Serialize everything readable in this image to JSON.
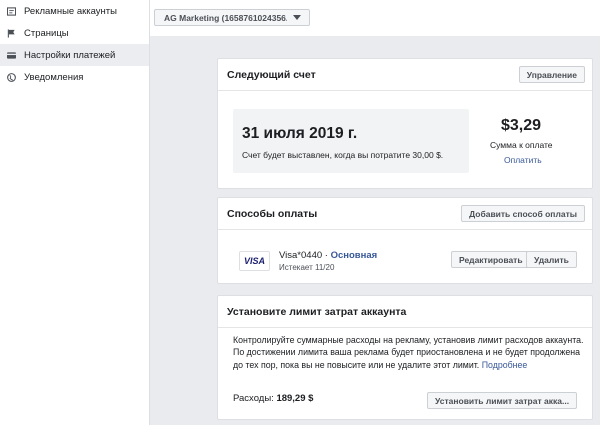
{
  "sidebar": {
    "items": [
      {
        "label": "Рекламные аккаунты",
        "icon": "ad-accounts-icon",
        "active": false
      },
      {
        "label": "Страницы",
        "icon": "flag-icon",
        "active": false
      },
      {
        "label": "Настройки платежей",
        "icon": "credit-card-icon",
        "active": true
      },
      {
        "label": "Уведомления",
        "icon": "globe-icon",
        "active": false
      }
    ]
  },
  "account_selector": {
    "value": "AG Marketing (1658761024356..."
  },
  "next_bill": {
    "title": "Следующий счет",
    "manage_label": "Управление",
    "date": "31 июля 2019 г.",
    "note": "Счет будет выставлен, когда вы потратите 30,00 $.",
    "amount": "$3,29",
    "amount_label": "Сумма к оплате",
    "pay_label": "Оплатить"
  },
  "payment_methods": {
    "title": "Способы оплаты",
    "add_label": "Добавить способ оплаты",
    "card": {
      "logo": "VISA",
      "number": "Visa*0440",
      "separator": " · ",
      "primary_label": "Основная",
      "expires": "Истекает 11/20"
    },
    "edit_label": "Редактировать",
    "delete_label": "Удалить"
  },
  "spending_limit": {
    "title": "Установите лимит затрат аккаунта",
    "description": "Контролируйте суммарные расходы на рекламу, установив лимит расходов аккаунта. По достижении лимита ваша реклама будет приостановлена и не будет продолжена до тех пор, пока вы не повысите или не удалите этот лимит.",
    "more_label": "Подробнее",
    "spent_label": "Расходы:",
    "spent_value": "189,29 $",
    "set_limit_label": "Установить лимит затрат акка..."
  },
  "colors": {
    "link": "#385898",
    "background": "#e9ebee",
    "active_item": "#ebedf0"
  }
}
